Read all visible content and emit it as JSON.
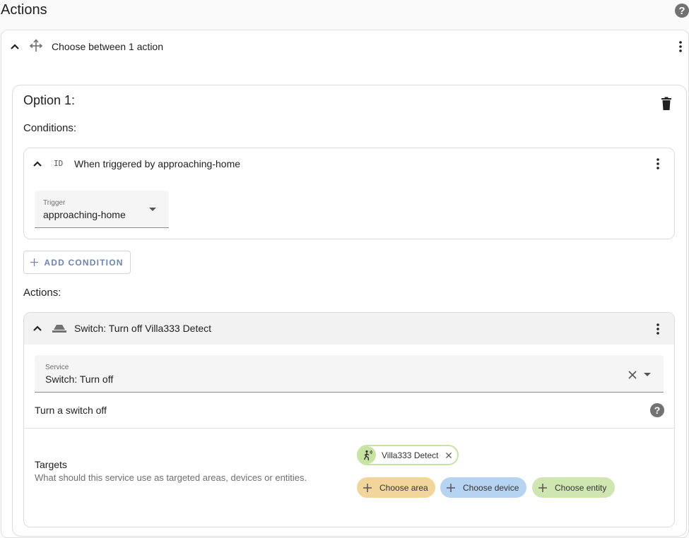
{
  "page": {
    "title": "Actions",
    "help_icon": "help-circle-icon",
    "help_glyph": "?"
  },
  "choose_block": {
    "title": "Choose between 1 action",
    "icon": "arrow-decision-icon"
  },
  "option": {
    "title": "Option 1:",
    "delete_icon": "trash-icon",
    "conditions_label": "Conditions:",
    "actions_label": "Actions:"
  },
  "condition": {
    "icon_text": "ID",
    "title": "When triggered by approaching-home",
    "trigger_label": "Trigger",
    "trigger_value": "approaching-home"
  },
  "add_condition": {
    "label": "ADD CONDITION"
  },
  "action": {
    "icon": "toggle-switch-off-icon",
    "title": "Switch: Turn off Villa333 Detect",
    "service_label": "Service",
    "service_value": "Switch: Turn off",
    "description": "Turn a switch off"
  },
  "targets": {
    "title": "Targets",
    "description": "What should this service use as targeted areas, devices or entities.",
    "selected": [
      {
        "label": "Villa333 Detect",
        "icon": "motion-sensor-icon"
      }
    ],
    "add_chips": [
      {
        "label": "Choose area",
        "color": "#f2d59b"
      },
      {
        "label": "Choose device",
        "color": "#b6d3f1"
      },
      {
        "label": "Choose entity",
        "color": "#cfe6b0"
      }
    ]
  },
  "colors": {
    "accent": "#6d84b4",
    "icon_gray": "#727272"
  }
}
